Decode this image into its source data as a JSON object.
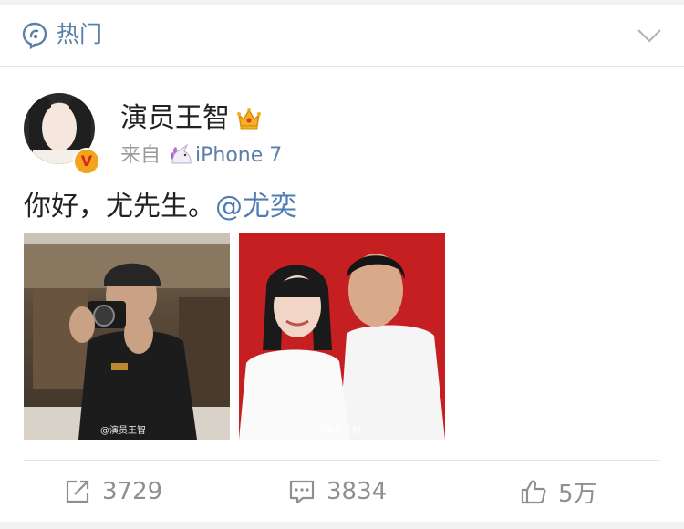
{
  "header": {
    "title": "热门",
    "icon": "hot-icon",
    "expand_icon": "chevron-down-icon"
  },
  "post": {
    "author": {
      "name": "演员王智",
      "verified_badge": "V",
      "member_icon": "crown-icon"
    },
    "source_prefix": "来自",
    "source_icon": "unicorn-icon",
    "source_device": "iPhone 7",
    "text": "你好，尤先生。",
    "mention": "@尤奕",
    "images": [
      {
        "name": "photo-man-camera",
        "watermark": "@演员王智"
      },
      {
        "name": "photo-couple",
        "watermark": "@演员王智"
      }
    ]
  },
  "actions": {
    "repost": {
      "icon": "share-icon",
      "count": "3729"
    },
    "comment": {
      "icon": "comment-icon",
      "count": "3834"
    },
    "like": {
      "icon": "thumbs-up-icon",
      "count": "5万"
    }
  },
  "colors": {
    "link": "#4f7db1",
    "text": "#222222",
    "muted": "#8f8f8f",
    "red_bg": "#c61f22"
  }
}
